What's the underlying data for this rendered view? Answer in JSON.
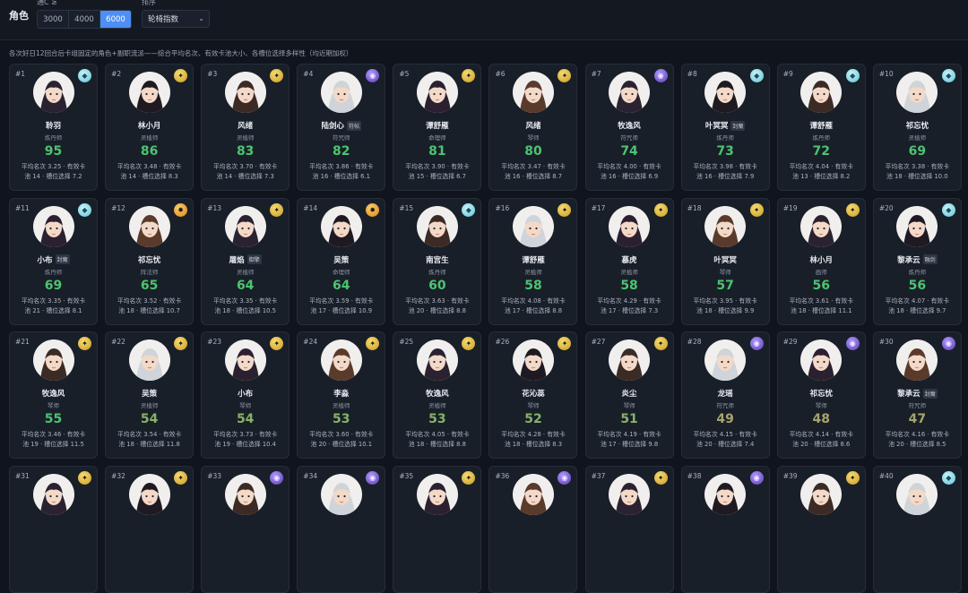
{
  "header": {
    "section_title": "角色",
    "filter_label": "通C ≥",
    "filter_options": [
      "3000",
      "4000",
      "6000"
    ],
    "filter_selected": "6000",
    "sort_label": "排序",
    "sort_value": "轮椅指数",
    "description": "各次好日12回合后卡组固定的角色+副职流派——综合平均名次、有效卡池大小、各槽位选择多样性（均近期加权）"
  },
  "colors": {
    "accent": "#4d8ef7",
    "score_high": "#4cc46f",
    "score_mid": "#84b468",
    "score_low": "#a7a46c",
    "card_bg": "#191f29"
  },
  "cards": [
    {
      "rank": "#1",
      "name": "聆羽",
      "tag": "",
      "role": "炼丹师",
      "score": "95",
      "badge": "cyan",
      "stats_line1": "平均名次 3.25 · 有效卡",
      "stats_line2": "池 14 · 槽位选择 7.2"
    },
    {
      "rank": "#2",
      "name": "林小月",
      "tag": "",
      "role": "灵植师",
      "score": "86",
      "badge": "gold",
      "stats_line1": "平均名次 3.48 · 有效卡",
      "stats_line2": "池 14 · 槽位选择 8.3"
    },
    {
      "rank": "#3",
      "name": "风绪",
      "tag": "",
      "role": "灵植师",
      "score": "83",
      "badge": "gold",
      "stats_line1": "平均名次 3.70 · 有效卡",
      "stats_line2": "池 14 · 槽位选择 7.3"
    },
    {
      "rank": "#4",
      "name": "陆剑心",
      "tag": "符帖",
      "role": "符咒师",
      "score": "82",
      "badge": "purple",
      "stats_line1": "平均名次 3.86 · 有效卡",
      "stats_line2": "池 16 · 槽位选择 6.1"
    },
    {
      "rank": "#5",
      "name": "谭舒雁",
      "tag": "",
      "role": "命理师",
      "score": "81",
      "badge": "gold",
      "stats_line1": "平均名次 3.90 · 有效卡",
      "stats_line2": "池 15 · 槽位选择 6.7"
    },
    {
      "rank": "#6",
      "name": "风绪",
      "tag": "",
      "role": "琴师",
      "score": "80",
      "badge": "gold",
      "stats_line1": "平均名次 3.47 · 有效卡",
      "stats_line2": "池 16 · 槽位选择 8.7"
    },
    {
      "rank": "#7",
      "name": "牧逸风",
      "tag": "",
      "role": "符咒师",
      "score": "74",
      "badge": "purple",
      "stats_line1": "平均名次 4.00 · 有效卡",
      "stats_line2": "池 16 · 槽位选择 6.9"
    },
    {
      "rank": "#8",
      "name": "叶冥冥",
      "tag": "封魔",
      "role": "炼丹师",
      "score": "73",
      "badge": "cyan",
      "stats_line1": "平均名次 3.98 · 有效卡",
      "stats_line2": "池 16 · 槽位选择 7.9"
    },
    {
      "rank": "#9",
      "name": "谭舒雁",
      "tag": "",
      "role": "炼丹师",
      "score": "72",
      "badge": "cyan",
      "stats_line1": "平均名次 4.04 · 有效卡",
      "stats_line2": "池 13 · 槽位选择 8.2"
    },
    {
      "rank": "#10",
      "name": "祁忘忧",
      "tag": "",
      "role": "灵植师",
      "score": "69",
      "badge": "cyan",
      "stats_line1": "平均名次 3.38 · 有效卡",
      "stats_line2": "池 18 · 槽位选择 10.0"
    },
    {
      "rank": "#11",
      "name": "小布",
      "tag": "封魔",
      "role": "炼丹师",
      "score": "69",
      "badge": "cyan",
      "stats_line1": "平均名次 3.35 · 有效卡",
      "stats_line2": "池 21 · 槽位选择 8.1"
    },
    {
      "rank": "#12",
      "name": "祁忘忧",
      "tag": "",
      "role": "阵法师",
      "score": "65",
      "badge": "orange",
      "stats_line1": "平均名次 3.52 · 有效卡",
      "stats_line2": "池 18 · 槽位选择 10.7"
    },
    {
      "rank": "#13",
      "name": "屠焰",
      "tag": "御擎",
      "role": "灵植师",
      "score": "64",
      "badge": "gold",
      "stats_line1": "平均名次 3.35 · 有效卡",
      "stats_line2": "池 18 · 槽位选择 10.5"
    },
    {
      "rank": "#14",
      "name": "吴策",
      "tag": "",
      "role": "命理师",
      "score": "64",
      "badge": "orange",
      "stats_line1": "平均名次 3.59 · 有效卡",
      "stats_line2": "池 17 · 槽位选择 10.9"
    },
    {
      "rank": "#15",
      "name": "南宫生",
      "tag": "",
      "role": "炼丹师",
      "score": "60",
      "badge": "cyan",
      "stats_line1": "平均名次 3.63 · 有效卡",
      "stats_line2": "池 20 · 槽位选择 8.8"
    },
    {
      "rank": "#16",
      "name": "谭舒雁",
      "tag": "",
      "role": "灵植师",
      "score": "58",
      "badge": "gold",
      "stats_line1": "平均名次 4.08 · 有效卡",
      "stats_line2": "池 17 · 槽位选择 8.8"
    },
    {
      "rank": "#17",
      "name": "慕虎",
      "tag": "",
      "role": "灵植师",
      "score": "58",
      "badge": "gold",
      "stats_line1": "平均名次 4.29 · 有效卡",
      "stats_line2": "池 17 · 槽位选择 7.3"
    },
    {
      "rank": "#18",
      "name": "叶冥冥",
      "tag": "",
      "role": "琴师",
      "score": "57",
      "badge": "gold",
      "stats_line1": "平均名次 3.95 · 有效卡",
      "stats_line2": "池 18 · 槽位选择 9.9"
    },
    {
      "rank": "#19",
      "name": "林小月",
      "tag": "",
      "role": "画师",
      "score": "56",
      "badge": "gold",
      "stats_line1": "平均名次 3.61 · 有效卡",
      "stats_line2": "池 18 · 槽位选择 11.1"
    },
    {
      "rank": "#20",
      "name": "黎承云",
      "tag": "融剑",
      "role": "炼丹师",
      "score": "56",
      "badge": "cyan",
      "stats_line1": "平均名次 4.07 · 有效卡",
      "stats_line2": "池 18 · 槽位选择 9.7"
    },
    {
      "rank": "#21",
      "name": "牧逸风",
      "tag": "",
      "role": "琴师",
      "score": "55",
      "badge": "gold",
      "stats_line1": "平均名次 3.46 · 有效卡",
      "stats_line2": "池 19 · 槽位选择 11.5"
    },
    {
      "rank": "#22",
      "name": "吴策",
      "tag": "",
      "role": "灵植师",
      "score": "54",
      "badge": "gold",
      "stats_line1": "平均名次 3.54 · 有效卡",
      "stats_line2": "池 18 · 槽位选择 11.8"
    },
    {
      "rank": "#23",
      "name": "小布",
      "tag": "",
      "role": "琴师",
      "score": "54",
      "badge": "gold",
      "stats_line1": "平均名次 3.73 · 有效卡",
      "stats_line2": "池 19 · 槽位选择 10.4"
    },
    {
      "rank": "#24",
      "name": "李淼",
      "tag": "",
      "role": "灵植师",
      "score": "53",
      "badge": "gold",
      "stats_line1": "平均名次 3.60 · 有效卡",
      "stats_line2": "池 20 · 槽位选择 10.1"
    },
    {
      "rank": "#25",
      "name": "牧逸风",
      "tag": "",
      "role": "灵植师",
      "score": "53",
      "badge": "gold",
      "stats_line1": "平均名次 4.05 · 有效卡",
      "stats_line2": "池 18 · 槽位选择 8.8"
    },
    {
      "rank": "#26",
      "name": "花沁蕊",
      "tag": "",
      "role": "琴师",
      "score": "52",
      "badge": "gold",
      "stats_line1": "平均名次 4.28 · 有效卡",
      "stats_line2": "池 18 · 槽位选择 8.3"
    },
    {
      "rank": "#27",
      "name": "炎尘",
      "tag": "",
      "role": "琴师",
      "score": "51",
      "badge": "gold",
      "stats_line1": "平均名次 4.19 · 有效卡",
      "stats_line2": "池 17 · 槽位选择 9.8"
    },
    {
      "rank": "#28",
      "name": "龙瑶",
      "tag": "",
      "role": "符咒师",
      "score": "49",
      "badge": "purple",
      "stats_line1": "平均名次 4.15 · 有效卡",
      "stats_line2": "池 20 · 槽位选择 7.4"
    },
    {
      "rank": "#29",
      "name": "祁忘忧",
      "tag": "",
      "role": "琴师",
      "score": "48",
      "badge": "purple",
      "stats_line1": "平均名次 4.14 · 有效卡",
      "stats_line2": "池 20 · 槽位选择 8.6"
    },
    {
      "rank": "#30",
      "name": "黎承云",
      "tag": "封魔",
      "role": "符咒师",
      "score": "47",
      "badge": "purple",
      "stats_line1": "平均名次 4.16 · 有效卡",
      "stats_line2": "池 20 · 槽位选择 8.5"
    },
    {
      "rank": "#31",
      "name": "",
      "tag": "",
      "role": "",
      "score": "",
      "badge": "gold",
      "stats_line1": "",
      "stats_line2": ""
    },
    {
      "rank": "#32",
      "name": "",
      "tag": "",
      "role": "",
      "score": "",
      "badge": "gold",
      "stats_line1": "",
      "stats_line2": ""
    },
    {
      "rank": "#33",
      "name": "",
      "tag": "",
      "role": "",
      "score": "",
      "badge": "purple",
      "stats_line1": "",
      "stats_line2": ""
    },
    {
      "rank": "#34",
      "name": "",
      "tag": "",
      "role": "",
      "score": "",
      "badge": "purple",
      "stats_line1": "",
      "stats_line2": ""
    },
    {
      "rank": "#35",
      "name": "",
      "tag": "",
      "role": "",
      "score": "",
      "badge": "gold",
      "stats_line1": "",
      "stats_line2": ""
    },
    {
      "rank": "#36",
      "name": "",
      "tag": "",
      "role": "",
      "score": "",
      "badge": "purple",
      "stats_line1": "",
      "stats_line2": ""
    },
    {
      "rank": "#37",
      "name": "",
      "tag": "",
      "role": "",
      "score": "",
      "badge": "gold",
      "stats_line1": "",
      "stats_line2": ""
    },
    {
      "rank": "#38",
      "name": "",
      "tag": "",
      "role": "",
      "score": "",
      "badge": "purple",
      "stats_line1": "",
      "stats_line2": ""
    },
    {
      "rank": "#39",
      "name": "",
      "tag": "",
      "role": "",
      "score": "",
      "badge": "gold",
      "stats_line1": "",
      "stats_line2": ""
    },
    {
      "rank": "#40",
      "name": "",
      "tag": "",
      "role": "",
      "score": "",
      "badge": "cyan",
      "stats_line1": "",
      "stats_line2": ""
    }
  ]
}
